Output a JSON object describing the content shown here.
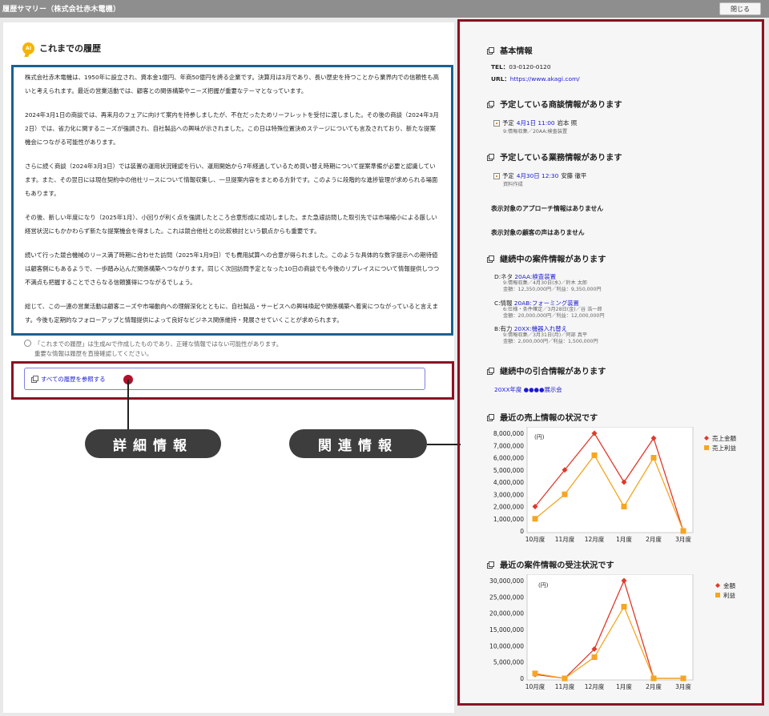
{
  "window": {
    "title": "履歴サマリー（株式会社赤木電機）",
    "close_label": "閉じる"
  },
  "history": {
    "heading": "これまでの履歴",
    "ai_icon_label": "AI",
    "paragraphs": [
      "株式会社赤木電機は、1950年に設立され、資本金1億円、年商50億円を誇る企業です。決算月は3月であり、長い歴史を持つことから業界内での信頼性も高いと考えられます。最近の営業活動では、顧客との関係構築やニーズ把握が重要なテーマとなっています。",
      "2024年3月1日の商談では、再来月のフェアに向けて案内を持参しましたが、不在だったためリーフレットを受付に渡しました。その後の商談（2024年3月2日）では、省力化に関するニーズが強調され、自社製品への興味が示されました。この日は特殊位置決めステージについても言及されており、新たな提案機会につながる可能性があります。",
      "さらに続く商談（2024年3月3日）では装置の運用状況確認を行い、運用開始から7年経過しているため買い替え時期について提案準備が必要と認識しています。また、その翌日には現在契約中の他社リースについて情報収集し、一旦提案内容をまとめる方針です。このように段階的な進捗管理が求められる場面もあります。",
      "その後、新しい年度になり（2025年1月）、小回りが利く点を強調したところ合意形成に成功しました。また急遽訪問した取引先では市場縮小による厳しい経営状況にもかかわらず新たな提案機会を得ました。これは競合他社との比較検討という観点からも重要です。",
      "続いて行った競合機械のリース満了時期に合わせた訪問（2025年1月9日）でも費用試算への合意が得られました。このような具体的な数字提示への期待値は顧客側にもあるようで、一歩踏み込んだ関係構築へつながります。同じく次回訪問予定となった10日の商談でも今後のリプレイスについて情報提供しつつ不満点も把握することでさらなる信頼獲得につながるでしょう。",
      "総じて、この一連の営業活動は顧客ニーズや市場動向への理解深化とともに、自社製品・サービスへの興味喚起や関係構築へ着実につながっていると言えます。今後も定期的なフォローアップと情報提供によって良好なビジネス関係維持・発展させていくことが求められます。"
    ],
    "ai_note_line1": "「これまでの履歴」は生成AIで作成したものであり、正確な情報ではない可能性があります。",
    "ai_note_line2": "重要な情報は履歴を直接確認してください。",
    "view_all_label": "すべての履歴を参照する"
  },
  "callouts": {
    "detail_label": "詳細情報",
    "related_label": "関連情報"
  },
  "basic_info": {
    "heading": "基本情報",
    "tel_label": "TEL：",
    "tel_value": "03-0120-0120",
    "url_label": "URL：",
    "url_value": "https://www.akagi.com/"
  },
  "planned_deals": {
    "heading": "予定している商談情報があります",
    "prefix": "予定",
    "date": "4月1日 11:00",
    "person": "岩本 照",
    "sub": "9:情報収集／20AA:検査装置"
  },
  "planned_tasks": {
    "heading": "予定している業務情報があります",
    "prefix": "予定",
    "date": "4月30日 12:30",
    "person": "安藤 徹平",
    "sub": "資料作成"
  },
  "no_approach": "表示対象のアプローチ情報はありません",
  "no_voice": "表示対象の顧客の声はありません",
  "cases": {
    "heading": "継続中の案件情報があります",
    "items": [
      {
        "rank": "D:ネタ",
        "name": "20AA:検査装置",
        "sub1": "9:情報収集／4月30日(水)／鈴木 太郎",
        "sub2": "金額：12,350,000円／利益：9,350,000円"
      },
      {
        "rank": "C:情報",
        "name": "20AB:フォーミング装置",
        "sub1": "6:仕様・条件確定／3月28日(金)／谷 浩一郎",
        "sub2": "金額：20,000,000円／利益：12,000,000円"
      },
      {
        "rank": "B:有力",
        "name": "20XX:機器入れ替え",
        "sub1": "9:情報収集／3月31日(月)／阿部 真平",
        "sub2": "金額：2,000,000円／利益：1,500,000円"
      }
    ]
  },
  "referrals": {
    "heading": "継続中の引合情報があります",
    "item": "20XX年度 ●●●●展示会"
  },
  "sales_chart_heading": "最近の売上情報の状況です",
  "orders_chart_heading": "最近の案件情報の受注状況です",
  "colors": {
    "frame_red": "#8b1123",
    "history_blue": "#1a6191",
    "series_red": "#e0392b",
    "series_orange": "#f5a623"
  },
  "chart_data": [
    {
      "type": "line",
      "unit_label": "(円)",
      "categories": [
        "10月度",
        "11月度",
        "12月度",
        "1月度",
        "2月度",
        "3月度"
      ],
      "ylim": [
        0,
        8000000
      ],
      "yticks": [
        "0",
        "1,000,000",
        "2,000,000",
        "3,000,000",
        "4,000,000",
        "5,000,000",
        "6,000,000",
        "7,000,000",
        "8,000,000"
      ],
      "series": [
        {
          "name": "売上金額",
          "values": [
            2000000,
            5000000,
            8000000,
            4000000,
            7600000,
            0
          ]
        },
        {
          "name": "売上利益",
          "values": [
            1000000,
            3000000,
            6200000,
            2000000,
            6000000,
            0
          ]
        }
      ],
      "legend": "top-right",
      "grid": false
    },
    {
      "type": "line",
      "unit_label": "(円)",
      "categories": [
        "10月度",
        "11月度",
        "12月度",
        "1月度",
        "2月度",
        "3月度"
      ],
      "ylim": [
        0,
        30000000
      ],
      "yticks": [
        "0",
        "5,000,000",
        "10,000,000",
        "15,000,000",
        "20,000,000",
        "25,000,000",
        "30,000,000"
      ],
      "series": [
        {
          "name": "金額",
          "values": [
            1200000,
            0,
            9000000,
            30000000,
            0,
            0
          ]
        },
        {
          "name": "利益",
          "values": [
            1500000,
            0,
            6500000,
            22000000,
            0,
            0
          ]
        }
      ],
      "legend": "top-right",
      "grid": false
    }
  ]
}
